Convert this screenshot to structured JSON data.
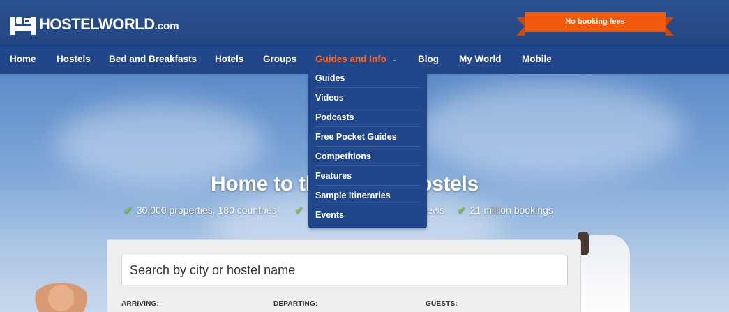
{
  "header": {
    "logo_main": "HOSTELWORLD",
    "logo_suffix": ".com",
    "banner": "No booking fees"
  },
  "nav": {
    "items": [
      {
        "label": "Home"
      },
      {
        "label": "Hostels"
      },
      {
        "label": "Bed and Breakfasts"
      },
      {
        "label": "Hotels"
      },
      {
        "label": "Groups"
      },
      {
        "label": "Guides and Info"
      },
      {
        "label": "Blog"
      },
      {
        "label": "My World"
      },
      {
        "label": "Mobile"
      }
    ],
    "active_index": 5
  },
  "dropdown": {
    "items": [
      {
        "label": "Guides"
      },
      {
        "label": "Videos"
      },
      {
        "label": "Podcasts"
      },
      {
        "label": "Free Pocket Guides"
      },
      {
        "label": "Competitions"
      },
      {
        "label": "Features"
      },
      {
        "label": "Sample Itineraries"
      },
      {
        "label": "Events"
      }
    ]
  },
  "hero": {
    "title": "Home to the wo        est Hostels",
    "stats": [
      {
        "text": "30,000 properties, 180 countries"
      },
      {
        "text": ""
      },
      {
        "text": "iews"
      },
      {
        "text": "21 million bookings"
      }
    ]
  },
  "search": {
    "placeholder": "Search by city or hostel name",
    "labels": {
      "arriving": "ARRIVING:",
      "departing": "DEPARTING:",
      "guests": "GUESTS:"
    }
  },
  "colors": {
    "header_blue": "#244683",
    "nav_blue": "#22468a",
    "active_orange": "#ff6a2a",
    "banner_orange": "#f15a0a",
    "check_green": "#7cc42c"
  }
}
